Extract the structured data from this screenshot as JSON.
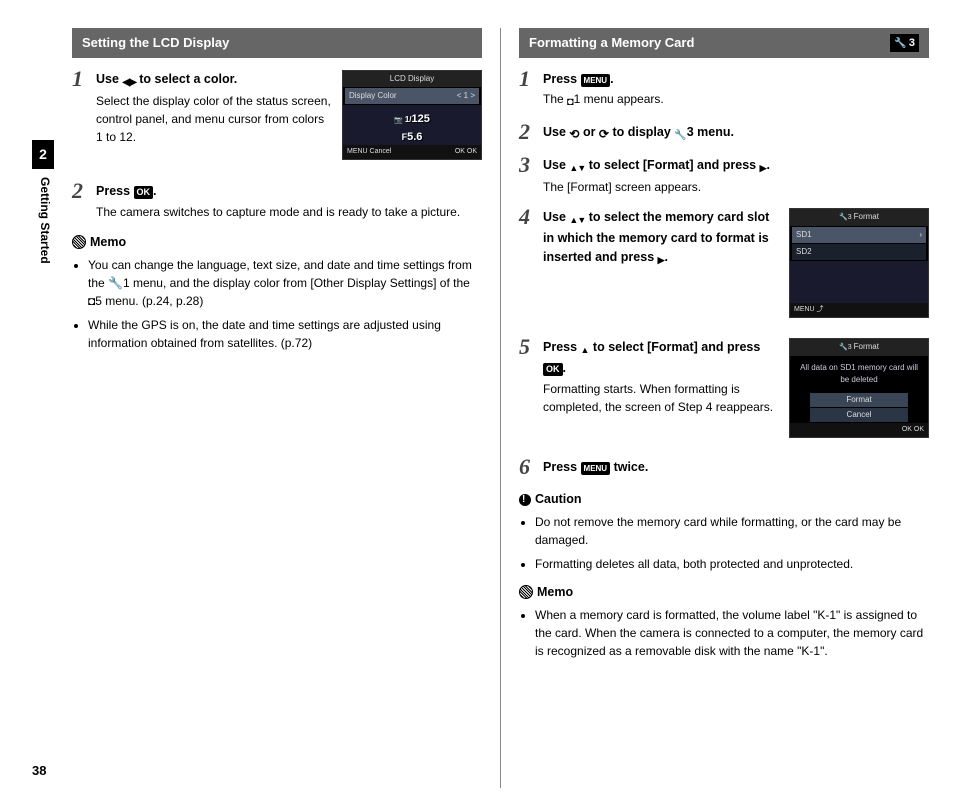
{
  "sideTab": {
    "chapter": "2",
    "label": "Getting Started"
  },
  "pageNumber": "38",
  "left": {
    "heading": "Setting the LCD Display",
    "step1": {
      "title_pre": "Use ",
      "title_post": " to select a color.",
      "desc": "Select the display color of the status screen, control panel, and menu cursor from colors 1 to 12."
    },
    "lcd1": {
      "title": "LCD Display",
      "row1_left": "Display Color",
      "row1_right": "<   1   >",
      "val1_pre": "1/",
      "val1": "125",
      "val2_pre": "F",
      "val2": "5.6",
      "foot_left": "MENU Cancel",
      "foot_right": "OK OK"
    },
    "step2": {
      "title_pre": "Press ",
      "title_post": ".",
      "desc": "The camera switches to capture mode and is ready to take a picture."
    },
    "memoHead": "Memo",
    "memo1": "You can change the language, text size, and date and time settings from the 🔧1 menu, and the display color from [Other Display Settings] of the ◘5 menu. (p.24, p.28)",
    "memo2": "While the GPS is on, the date and time settings are adjusted using information obtained from satellites. (p.72)"
  },
  "right": {
    "heading": "Formatting a Memory Card",
    "badge": "3",
    "step1": {
      "title_pre": "Press ",
      "title_post": ".",
      "desc_pre": "The ",
      "desc_post": "1 menu appears."
    },
    "step2": {
      "title_pre": "Use ",
      "title_mid": " or ",
      "title_mid2": " to display ",
      "title_post": "3 menu."
    },
    "step3": {
      "title_pre": "Use ",
      "title_mid": " to select [Format] and press ",
      "title_post": ".",
      "desc": "The [Format] screen appears."
    },
    "step4": {
      "title_pre": "Use ",
      "title_mid": " to select the memory card slot in which the memory card to format is inserted and press ",
      "title_post": "."
    },
    "lcd4": {
      "title": "Format",
      "opt1": "SD1",
      "opt2": "SD2",
      "foot": "MENU ⤴"
    },
    "step5": {
      "title_pre": "Press ",
      "title_mid": " to select [Format] and press ",
      "title_post": ".",
      "desc": "Formatting starts. When formatting is completed, the screen of Step 4 reappears."
    },
    "lcd5": {
      "title": "Format",
      "msg": "All data on SD1 memory card will be deleted",
      "btn1": "Format",
      "btn2": "Cancel",
      "foot": "OK OK"
    },
    "step6": {
      "title_pre": "Press ",
      "title_post": " twice."
    },
    "cautionHead": "Caution",
    "caution1": "Do not remove the memory card while formatting, or the card may be damaged.",
    "caution2": "Formatting deletes all data, both protected and unprotected.",
    "memoHead": "Memo",
    "memo1": "When a memory card is formatted, the volume label \"K-1\" is assigned to the card. When the camera is connected to a computer, the memory card is recognized as a removable disk with the name \"K-1\"."
  }
}
